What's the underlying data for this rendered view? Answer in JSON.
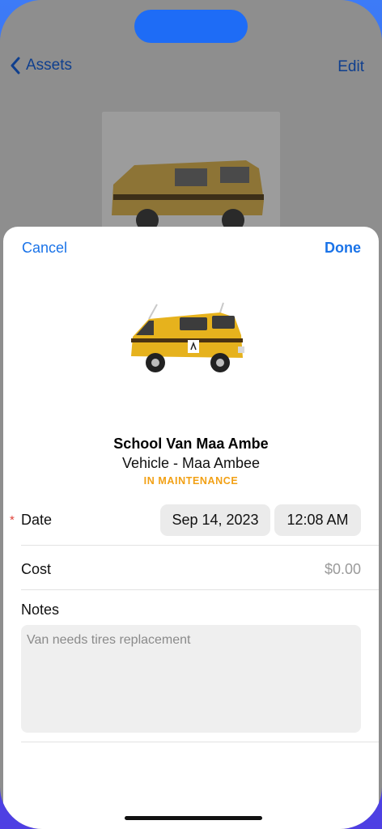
{
  "background_nav": {
    "back_label": "Assets",
    "edit_label": "Edit"
  },
  "sheet": {
    "cancel_label": "Cancel",
    "done_label": "Done"
  },
  "asset": {
    "name": "School Van Maa Ambe",
    "subtitle": "Vehicle - Maa Ambee",
    "status": "IN MAINTENANCE",
    "status_color": "#f2a014"
  },
  "form": {
    "date_label": "Date",
    "required_mark": "*",
    "date_value": "Sep 14, 2023",
    "time_value": "12:08 AM",
    "cost_label": "Cost",
    "cost_value": "$0.00",
    "notes_label": "Notes",
    "notes_value": "Van needs tires replacement"
  },
  "colors": {
    "accent": "#1a73e8",
    "required": "#e0433a"
  }
}
